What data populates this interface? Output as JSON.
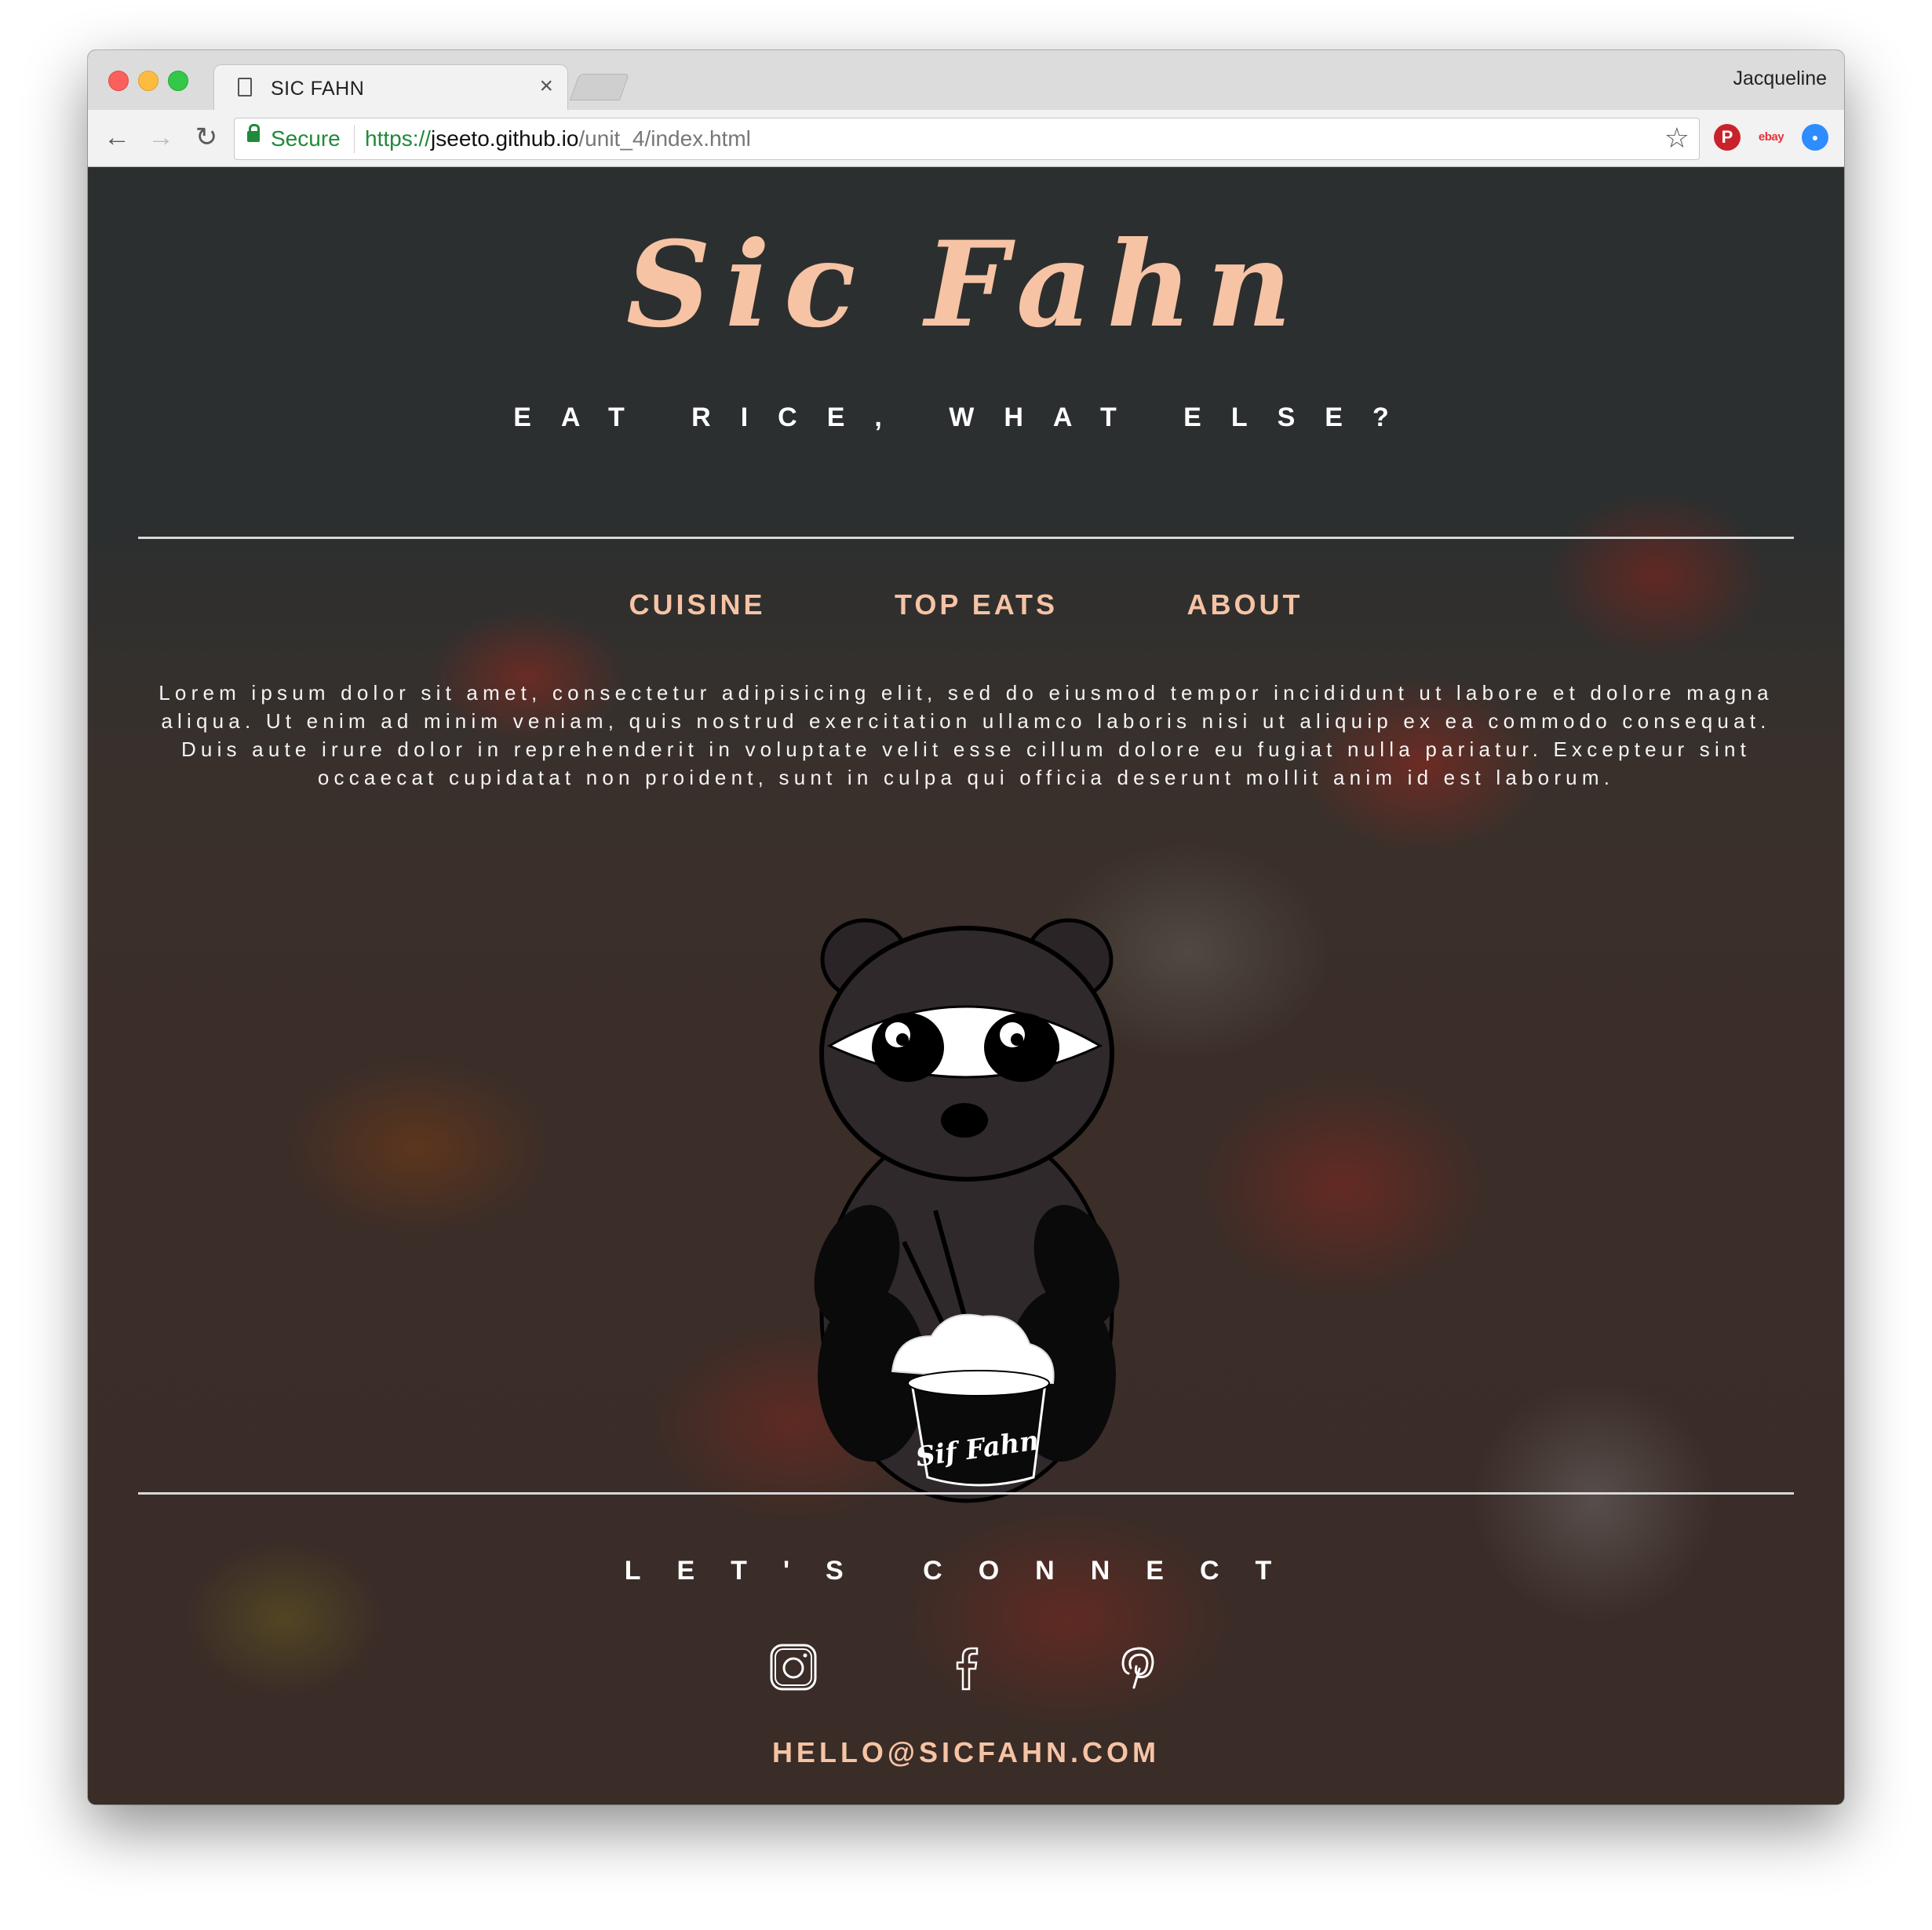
{
  "browser": {
    "tab_title": "SIC FAHN",
    "tab_close": "×",
    "profile_name": "Jacqueline",
    "secure_label": "Secure",
    "url_scheme": "https://",
    "url_host": "jseeto.github.io",
    "url_path": "/unit_4/index.html",
    "nav": {
      "back": "←",
      "forward": "→",
      "reload": "↻"
    },
    "star": "☆",
    "extensions": [
      {
        "name": "pinterest-extension-icon",
        "glyph": "P"
      },
      {
        "name": "ebay-extension-icon",
        "glyph": "ebay"
      },
      {
        "name": "zoom-extension-icon",
        "glyph": "●"
      },
      {
        "name": "drive-extension-icon",
        "glyph": ""
      }
    ],
    "menu": "⋮"
  },
  "site": {
    "logo": "Sic Fahn",
    "tagline": "EAT RICE, WHAT ELSE?",
    "nav": [
      {
        "label": "CUISINE"
      },
      {
        "label": "TOP EATS"
      },
      {
        "label": "ABOUT"
      }
    ],
    "intro": "Lorem ipsum dolor sit amet, consectetur adipisicing elit, sed do eiusmod tempor incididunt ut labore et dolore magna aliqua. Ut enim ad minim veniam, quis nostrud exercitation ullamco laboris nisi ut aliquip ex ea commodo consequat. Duis aute irure dolor in reprehenderit in voluptate velit esse cillum dolore eu fugiat nulla pariatur. Excepteur sint occaecat cupidatat non proident, sunt in culpa qui officia deserunt mollit anim id est laborum.",
    "mascot_bowl_text": "Sif Fahn",
    "connect_heading": "LET'S CONNECT",
    "social": [
      "instagram-icon",
      "facebook-icon",
      "pinterest-icon"
    ],
    "email": "HELLO@SICFAHN.COM"
  },
  "colors": {
    "accent": "#f6c3a4",
    "background": "#2b2d2d",
    "text": "#ffffff"
  }
}
